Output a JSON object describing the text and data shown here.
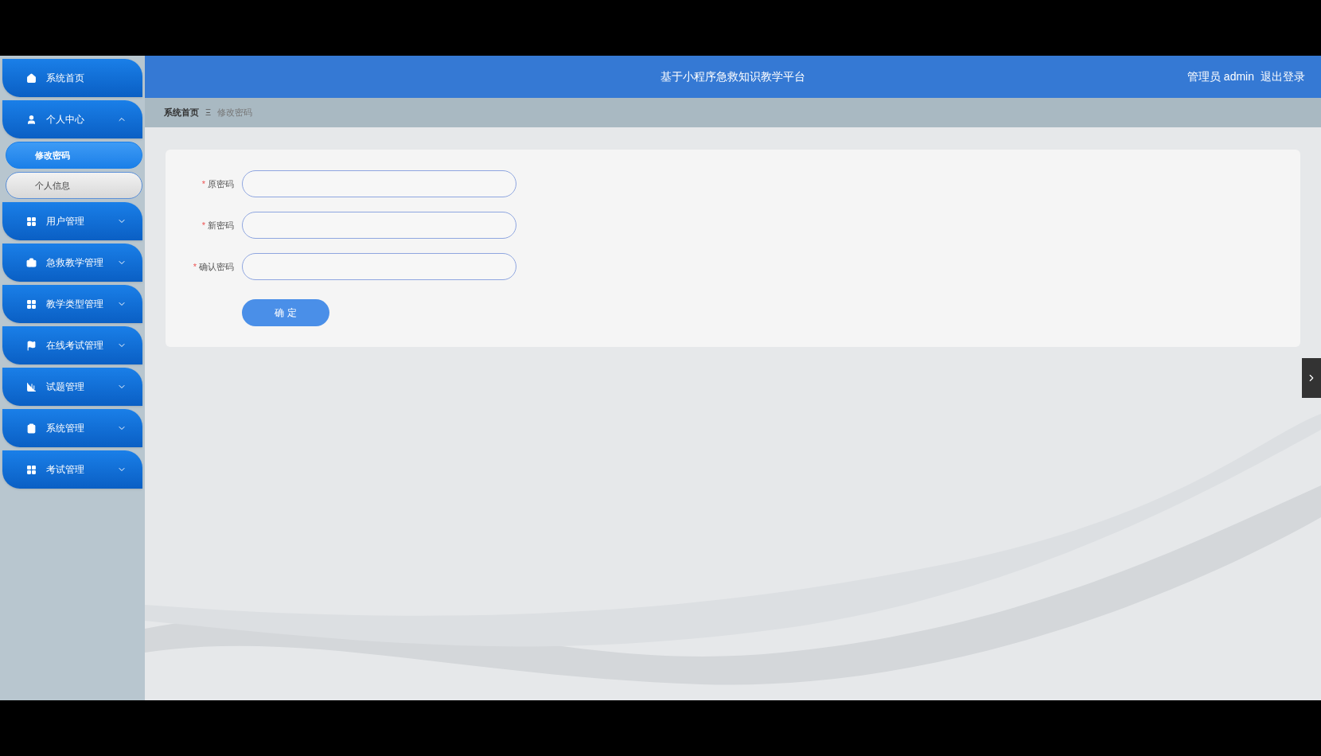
{
  "header": {
    "title": "基于小程序急救知识教学平台",
    "user": "管理员 admin",
    "logout": "退出登录"
  },
  "sidebar": {
    "items": [
      {
        "kind": "link",
        "label": "系统首页"
      },
      {
        "kind": "menu",
        "label": "个人中心",
        "expanded": true,
        "children": [
          {
            "label": "修改密码",
            "selected": true
          },
          {
            "label": "个人信息",
            "selected": false
          }
        ]
      },
      {
        "kind": "menu",
        "label": "用户管理",
        "expanded": false
      },
      {
        "kind": "menu",
        "label": "急救教学管理",
        "expanded": false
      },
      {
        "kind": "menu",
        "label": "教学类型管理",
        "expanded": false
      },
      {
        "kind": "menu",
        "label": "在线考试管理",
        "expanded": false
      },
      {
        "kind": "menu",
        "label": "试题管理",
        "expanded": false
      },
      {
        "kind": "menu",
        "label": "系统管理",
        "expanded": false
      },
      {
        "kind": "menu",
        "label": "考试管理",
        "expanded": false
      }
    ]
  },
  "breadcrumb": {
    "items": [
      "系统首页",
      "修改密码"
    ],
    "separator": "Ξ"
  },
  "form": {
    "required_mark": "*",
    "fields": [
      {
        "label": "原密码",
        "required": true
      },
      {
        "label": "新密码",
        "required": true
      },
      {
        "label": "确认密码",
        "required": true
      }
    ],
    "submit": "确 定"
  }
}
